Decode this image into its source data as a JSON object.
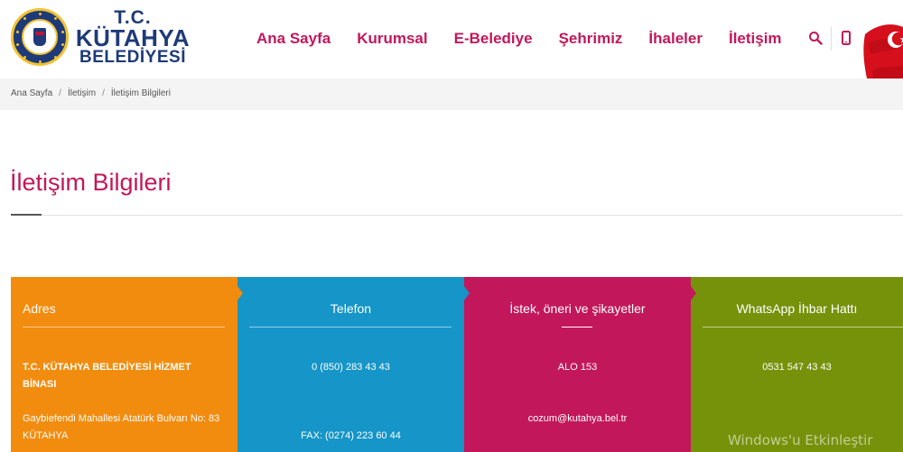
{
  "logo": {
    "line1": "T.C.",
    "line2": "KÜTAHYA",
    "line3": "BELEDİYESİ"
  },
  "nav": {
    "items": [
      {
        "label": "Ana Sayfa"
      },
      {
        "label": "Kurumsal"
      },
      {
        "label": "E-Belediye"
      },
      {
        "label": "Şehrimiz"
      },
      {
        "label": "İhaleler"
      },
      {
        "label": "İletişim"
      }
    ],
    "icons": [
      "search-icon",
      "phone-icon"
    ],
    "accent_color": "#c2185b"
  },
  "breadcrumb": {
    "items": [
      "Ana Sayfa",
      "İletişim",
      "İletişim Bilgileri"
    ],
    "separator": "/"
  },
  "page": {
    "title": "İletişim Bilgileri"
  },
  "cards": [
    {
      "title": "Adres",
      "color": "#f28c0f",
      "lines": [
        "T.C. KÜTAHYA BELEDİYESİ HİZMET BİNASI",
        "Gaybiefendi Mahallesi Atatürk Bulvarı No: 83 KÜTAHYA"
      ]
    },
    {
      "title": "Telefon",
      "color": "#1595c8",
      "lines": [
        "0 (850) 283 43 43",
        "FAX: (0274) 223 60 44"
      ]
    },
    {
      "title": "İstek, öneri ve şikayetler",
      "color": "#c2185b",
      "lines": [
        "ALO 153",
        "cozum@kutahya.bel.tr"
      ]
    },
    {
      "title": "WhatsApp İhbar Hattı",
      "color": "#76920b",
      "lines": [
        "0531 547 43 43"
      ]
    }
  ],
  "watermark": "Windows'u Etkinleştir"
}
